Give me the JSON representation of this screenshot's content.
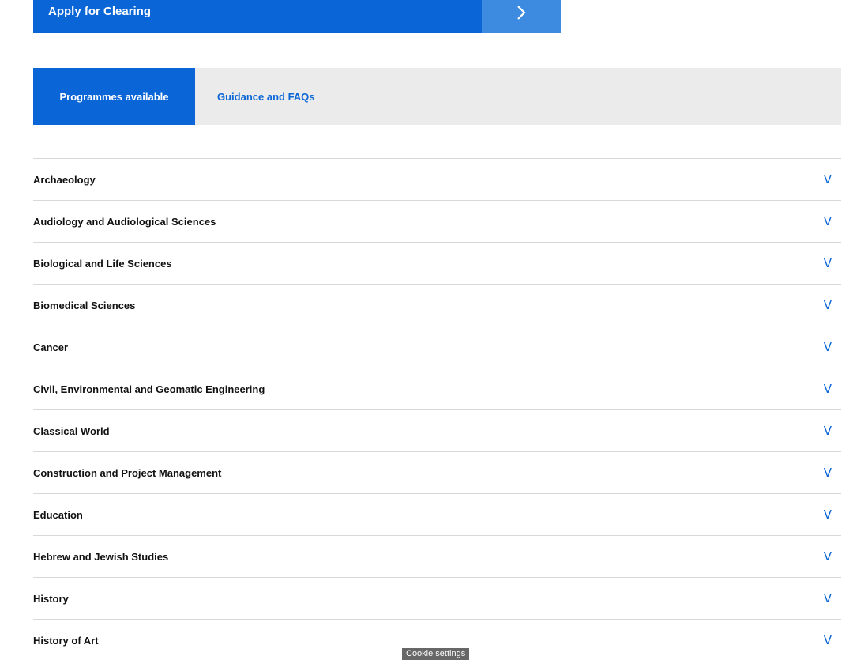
{
  "apply": {
    "label": "Apply for Clearing",
    "arrow_icon": "chevron-right-icon"
  },
  "tabs": [
    {
      "label": "Programmes available",
      "active": true
    },
    {
      "label": "Guidance and FAQs",
      "active": false
    }
  ],
  "programmes": [
    {
      "label": "Archaeology",
      "toggle": "V"
    },
    {
      "label": "Audiology and Audiological Sciences",
      "toggle": "V"
    },
    {
      "label": "Biological and Life Sciences",
      "toggle": "V"
    },
    {
      "label": "Biomedical Sciences",
      "toggle": "V"
    },
    {
      "label": "Cancer",
      "toggle": "V"
    },
    {
      "label": "Civil, Environmental and Geomatic Engineering",
      "toggle": "V"
    },
    {
      "label": "Classical World",
      "toggle": "V"
    },
    {
      "label": "Construction and Project Management",
      "toggle": "V"
    },
    {
      "label": "Education",
      "toggle": "V"
    },
    {
      "label": "Hebrew and Jewish Studies",
      "toggle": "V"
    },
    {
      "label": "History",
      "toggle": "V"
    },
    {
      "label": "History of Art",
      "toggle": "V"
    }
  ],
  "cookie": {
    "label": "Cookie settings"
  },
  "colors": {
    "brand_blue": "#0a66d6",
    "arrow_blue": "#3d8be0",
    "tab_bg": "#ebebeb",
    "divider": "#d8d8d8"
  }
}
